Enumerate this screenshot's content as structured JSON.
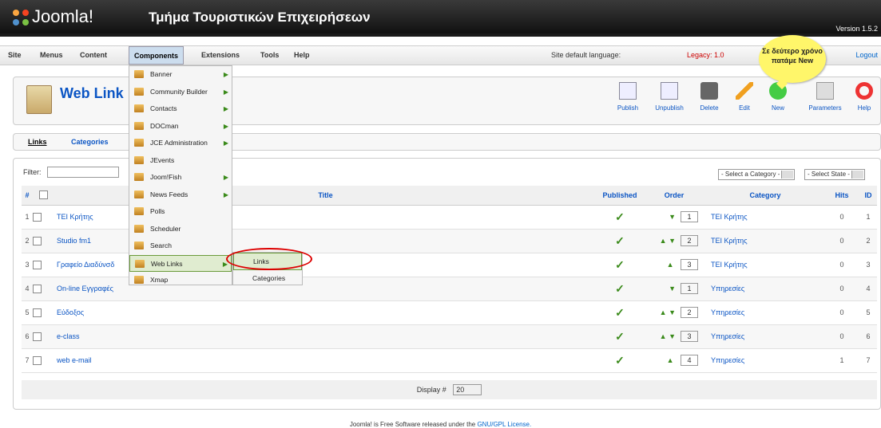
{
  "header": {
    "brand": "Joomla!",
    "site_name": "Τμήμα Τουριστικών Επιχειρήσεων",
    "version": "Version 1.5.2"
  },
  "menu": {
    "items": [
      "Site",
      "Menus",
      "Content",
      "Components",
      "Extensions",
      "Tools",
      "Help"
    ],
    "language": "Site default language:",
    "legacy": "Legacy: 1.0",
    "logout": "Logout"
  },
  "components_menu": [
    {
      "label": "Banner",
      "sub": true
    },
    {
      "label": "Community Builder",
      "sub": true
    },
    {
      "label": "Contacts",
      "sub": true
    },
    {
      "label": "DOCman",
      "sub": true
    },
    {
      "label": "JCE Administration",
      "sub": true
    },
    {
      "label": "JEvents",
      "sub": false
    },
    {
      "label": "Joom!Fish",
      "sub": true
    },
    {
      "label": "News Feeds",
      "sub": true
    },
    {
      "label": "Polls",
      "sub": false
    },
    {
      "label": "Scheduler",
      "sub": false
    },
    {
      "label": "Search",
      "sub": false
    },
    {
      "label": "Web Links",
      "sub": true
    },
    {
      "label": "Xmap",
      "sub": false
    }
  ],
  "submenu": [
    "Links",
    "Categories"
  ],
  "callout": "Σε δεύτερο χρόνο πατάμε New",
  "toolbar": {
    "title": "Web Link",
    "buttons": [
      "Publish",
      "Unpublish",
      "Delete",
      "Edit",
      "New",
      "Parameters",
      "Help"
    ]
  },
  "subnav": [
    "Links",
    "Categories"
  ],
  "filter": {
    "label": "Filter:",
    "category_select": "- Select a Category -",
    "state_select": "- Select State -"
  },
  "table": {
    "headers": {
      "num": "#",
      "title": "Title",
      "published": "Published",
      "order": "Order",
      "category": "Category",
      "hits": "Hits",
      "id": "ID"
    },
    "rows": [
      {
        "num": "1",
        "title": "TEI Κρήτης",
        "up": false,
        "down": true,
        "order": "1",
        "category": "TEI Κρήτης",
        "hits": "0",
        "id": "1"
      },
      {
        "num": "2",
        "title": "Studio fm1",
        "up": true,
        "down": true,
        "order": "2",
        "category": "TEI Κρήτης",
        "hits": "0",
        "id": "2"
      },
      {
        "num": "3",
        "title": "Γραφείο Διαδύνσδ",
        "up": true,
        "down": false,
        "order": "3",
        "category": "TEI Κρήτης",
        "hits": "0",
        "id": "3"
      },
      {
        "num": "4",
        "title": "On-line Εγγραφές",
        "up": false,
        "down": true,
        "order": "1",
        "category": "Υπηρεσίες",
        "hits": "0",
        "id": "4"
      },
      {
        "num": "5",
        "title": "Εύδοξος",
        "up": true,
        "down": true,
        "order": "2",
        "category": "Υπηρεσίες",
        "hits": "0",
        "id": "5"
      },
      {
        "num": "6",
        "title": "e-class",
        "up": true,
        "down": true,
        "order": "3",
        "category": "Υπηρεσίες",
        "hits": "0",
        "id": "6"
      },
      {
        "num": "7",
        "title": "web e-mail",
        "up": true,
        "down": false,
        "order": "4",
        "category": "Υπηρεσίες",
        "hits": "1",
        "id": "7"
      }
    ],
    "display_label": "Display #",
    "display_value": "20"
  },
  "footer": {
    "text": "Joomla! is Free Software released under the ",
    "link": "GNU/GPL License."
  }
}
